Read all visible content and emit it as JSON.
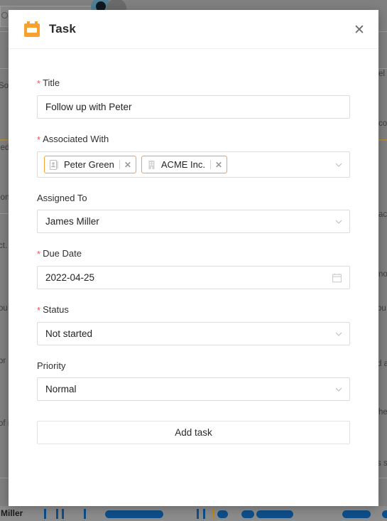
{
  "modal": {
    "title": "Task",
    "icon": "calendar-icon",
    "close_label": "✕",
    "accent_color": "#F9A12E",
    "required_marker": "*",
    "fields": [
      {
        "key": "title",
        "label": "Title",
        "required": true,
        "type": "text",
        "value": "Follow up with Peter"
      },
      {
        "key": "associated_with",
        "label": "Associated With",
        "required": true,
        "type": "multiselect",
        "tags": [
          {
            "label": "Peter Green",
            "icon": "contact-card-icon",
            "remove_label": "✕"
          },
          {
            "label": "ACME Inc.",
            "icon": "building-icon",
            "remove_label": "✕"
          }
        ]
      },
      {
        "key": "assigned_to",
        "label": "Assigned To",
        "required": false,
        "type": "select",
        "value": "James Miller"
      },
      {
        "key": "due_date",
        "label": "Due Date",
        "required": true,
        "type": "date",
        "value": "2022-04-25"
      },
      {
        "key": "status",
        "label": "Status",
        "required": true,
        "type": "select",
        "value": "Not started"
      },
      {
        "key": "priority",
        "label": "Priority",
        "required": false,
        "type": "select",
        "value": "Normal"
      }
    ],
    "submit_label": "Add task"
  },
  "background": {
    "left_fragments": [
      "Sol",
      "ied",
      "lon",
      "ct.",
      "ou",
      "or",
      "of i"
    ],
    "right_fragments": [
      "el",
      "co",
      "ac",
      "no",
      "ou",
      "d a",
      "he",
      "s s"
    ],
    "timeline_label": "Miller"
  }
}
